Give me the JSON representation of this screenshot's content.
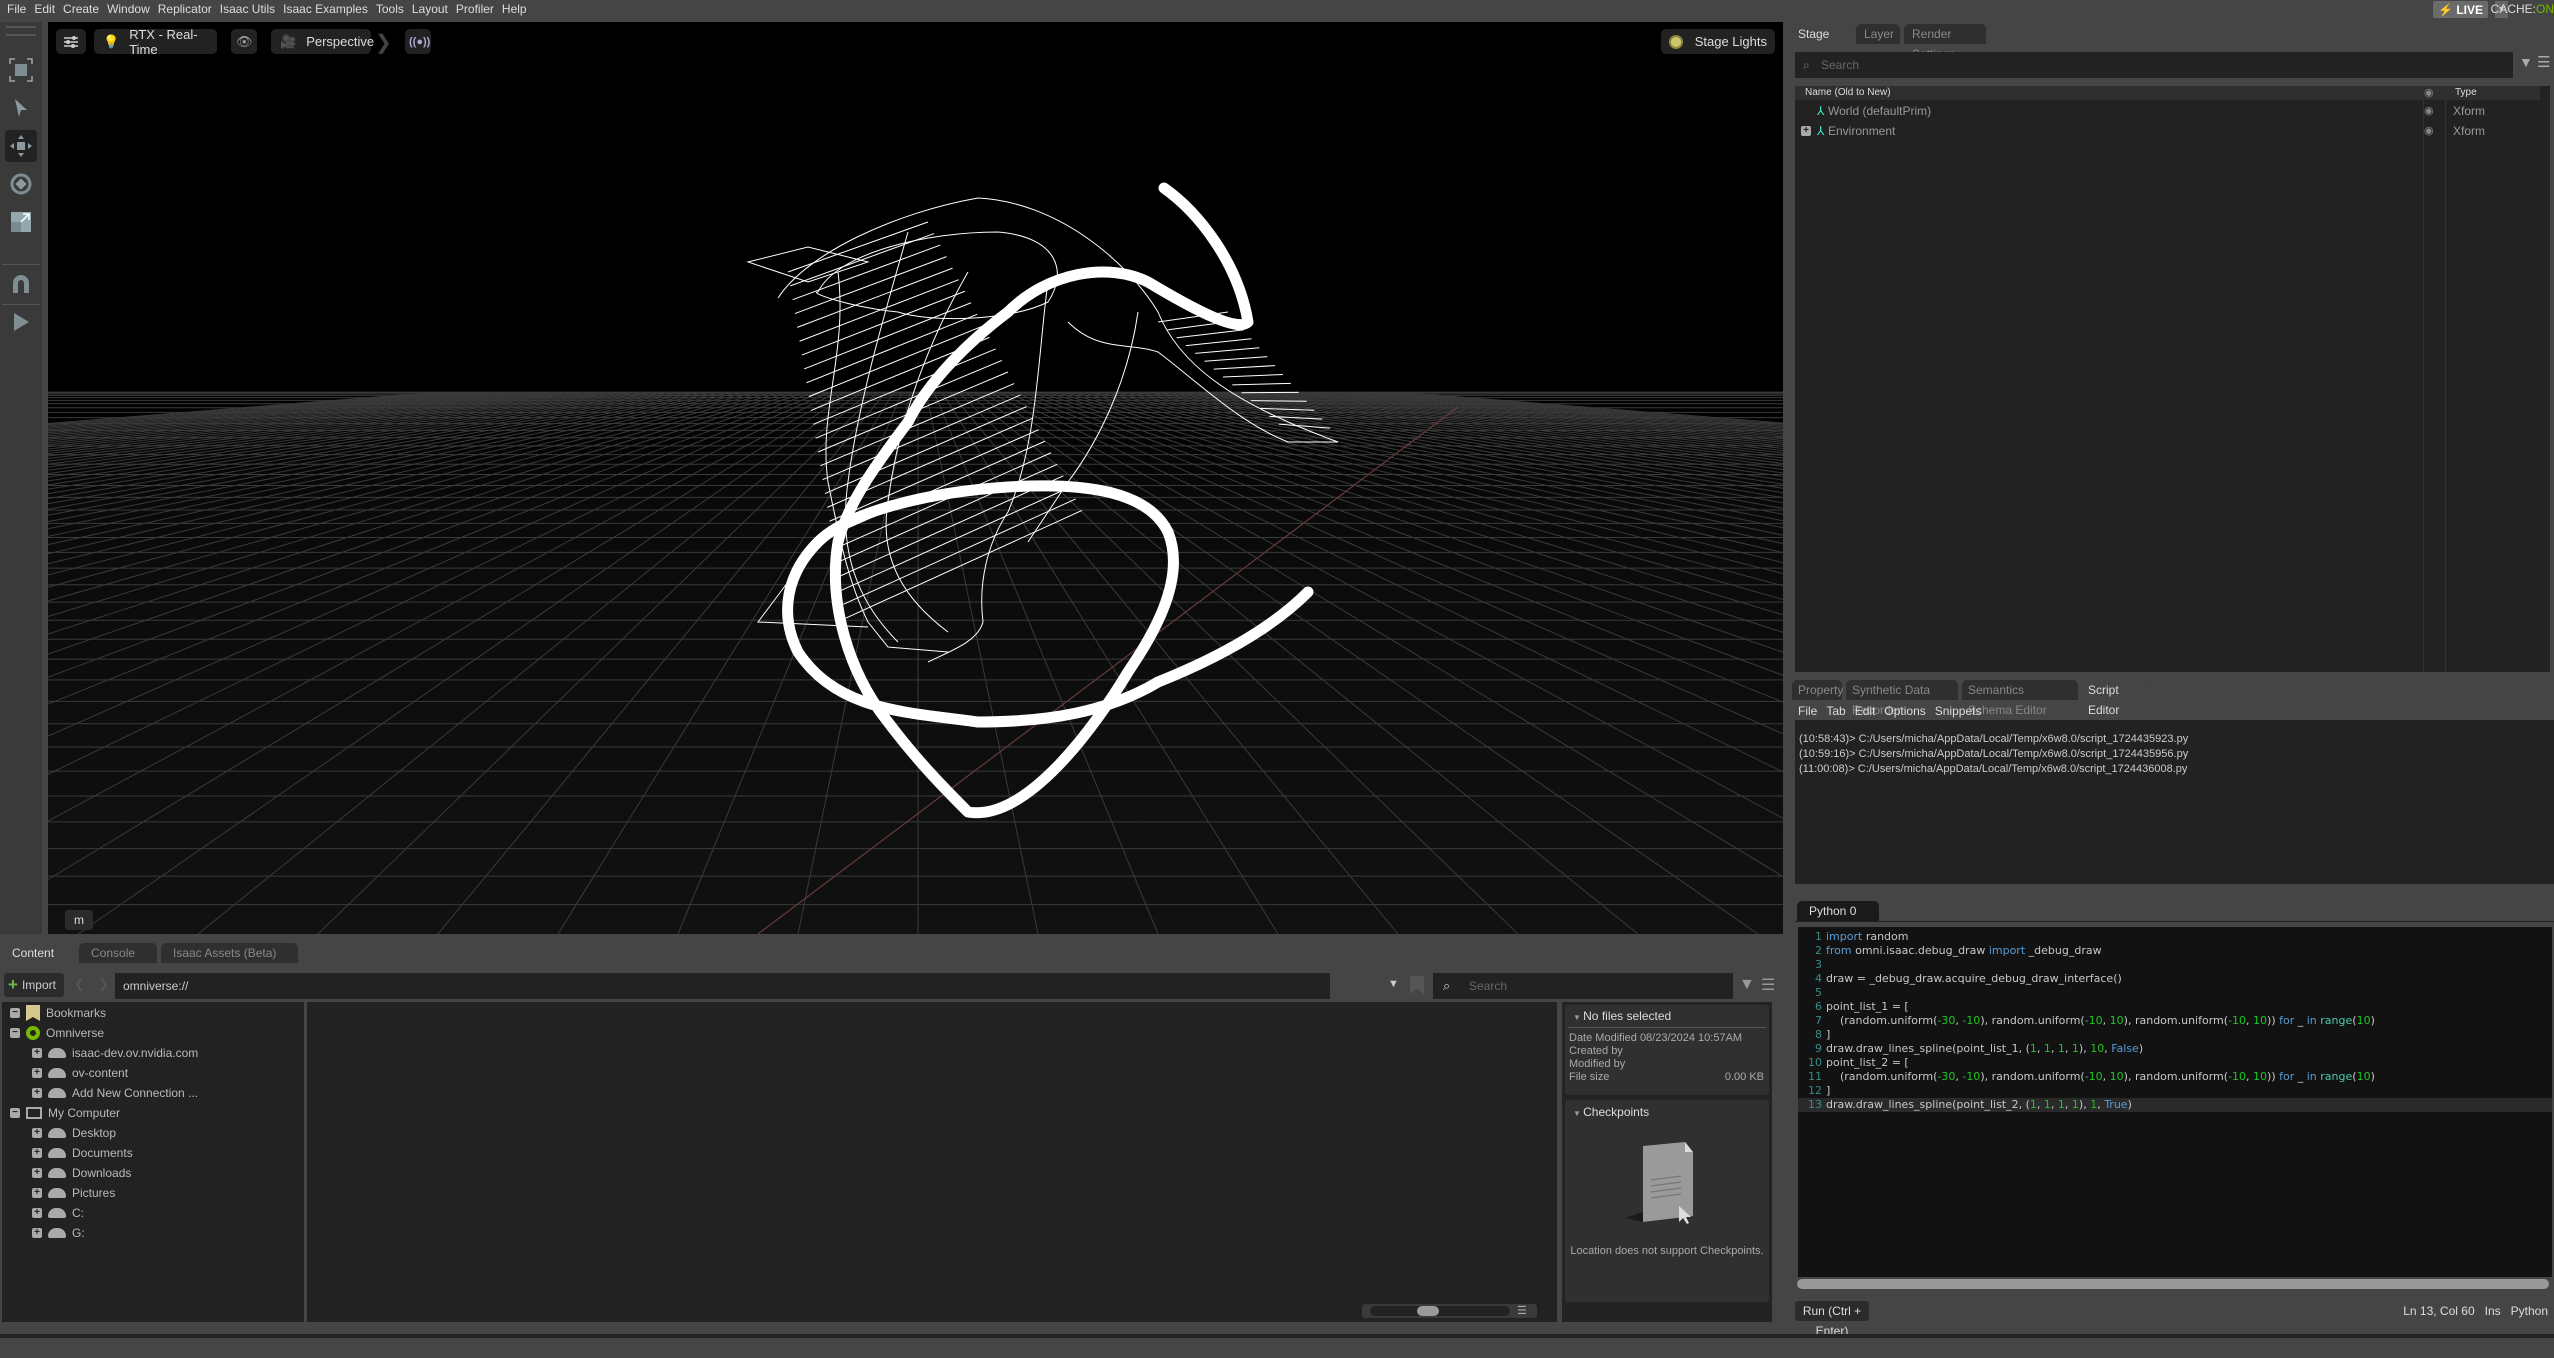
{
  "menubar": {
    "items": [
      "File",
      "Edit",
      "Create",
      "Window",
      "Replicator",
      "Isaac Utils",
      "Isaac Examples",
      "Tools",
      "Layout",
      "Profiler",
      "Help"
    ],
    "live_label": "LIVE",
    "cache_label": "CACHE:",
    "cache_value": "ON"
  },
  "viewport": {
    "renderer": "RTX - Real-Time",
    "camera": "Perspective",
    "stage_lights": "Stage Lights",
    "m_badge": "m"
  },
  "tools": [
    "select-cube",
    "select",
    "move",
    "rotate",
    "scale",
    "snap",
    "play"
  ],
  "stage": {
    "tabs": [
      "Stage",
      "Layer",
      "Render Settings"
    ],
    "active_tab": "Stage",
    "search_placeholder": "Search",
    "col_name": "Name (Old to New)",
    "col_type": "Type",
    "rows": [
      {
        "name": "World (defaultPrim)",
        "type": "Xform",
        "expandable": false
      },
      {
        "name": "Environment",
        "type": "Xform",
        "expandable": true
      }
    ]
  },
  "property": {
    "tabs": [
      "Property",
      "Synthetic Data Recorder",
      "Semantics Schema Editor",
      "Script Editor"
    ],
    "active_tab": "Script Editor",
    "menu": [
      "File",
      "Tab",
      "Edit",
      "Options",
      "Snippets"
    ],
    "log": [
      "(10:58:43)> C:/Users/micha/AppData/Local/Temp/x6w8.0/script_1724435923.py",
      "(10:59:16)> C:/Users/micha/AppData/Local/Temp/x6w8.0/script_1724435956.py",
      "(11:00:08)> C:/Users/micha/AppData/Local/Temp/x6w8.0/script_1724436008.py"
    ]
  },
  "editor": {
    "tab": "Python 0",
    "lines": [
      "import random",
      "from omni.isaac.debug_draw import _debug_draw",
      "",
      "draw = _debug_draw.acquire_debug_draw_interface()",
      "",
      "point_list_1 = [",
      "    (random.uniform(-30, -10), random.uniform(-10, 10), random.uniform(-10, 10)) for _ in range(10)",
      "]",
      "draw.draw_lines_spline(point_list_1, (1, 1, 1, 1), 10, False)",
      "point_list_2 = [",
      "    (random.uniform(-30, -10), random.uniform(-10, 10), random.uniform(-10, 10)) for _ in range(10)",
      "]",
      "draw.draw_lines_spline(point_list_2, (1, 1, 1, 1), 1, True)"
    ],
    "run_button": "Run (Ctrl + Enter)",
    "status_pos": "Ln 13, Col 60",
    "status_mode": "Ins",
    "status_lang": "Python"
  },
  "content": {
    "tabs": [
      "Content",
      "Console",
      "Isaac Assets (Beta)"
    ],
    "active_tab": "Content",
    "import_label": "Import",
    "path": "omniverse://",
    "search_placeholder": "Search",
    "tree": [
      {
        "label": "Bookmarks",
        "level": 0,
        "icon": "bookmark"
      },
      {
        "label": "Omniverse",
        "level": 0,
        "icon": "omniverse"
      },
      {
        "label": "isaac-dev.ov.nvidia.com",
        "level": 1,
        "icon": "drive"
      },
      {
        "label": "ov-content",
        "level": 1,
        "icon": "drive"
      },
      {
        "label": "Add New Connection ...",
        "level": 1,
        "icon": "add-drive"
      },
      {
        "label": "My Computer",
        "level": 0,
        "icon": "computer"
      },
      {
        "label": "Desktop",
        "level": 1,
        "icon": "drive"
      },
      {
        "label": "Documents",
        "level": 1,
        "icon": "drive"
      },
      {
        "label": "Downloads",
        "level": 1,
        "icon": "drive"
      },
      {
        "label": "Pictures",
        "level": 1,
        "icon": "drive"
      },
      {
        "label": "C:",
        "level": 1,
        "icon": "drive"
      },
      {
        "label": "G:",
        "level": 1,
        "icon": "drive"
      }
    ],
    "info": {
      "header": "No files selected",
      "date_modified_label": "Date Modified",
      "date_modified": "08/23/2024 10:57AM",
      "created_by_label": "Created by",
      "modified_by_label": "Modified by",
      "file_size_label": "File size",
      "file_size": "0.00 KB",
      "checkpoints_header": "Checkpoints",
      "checkpoints_msg": "Location does not support Checkpoints."
    }
  }
}
